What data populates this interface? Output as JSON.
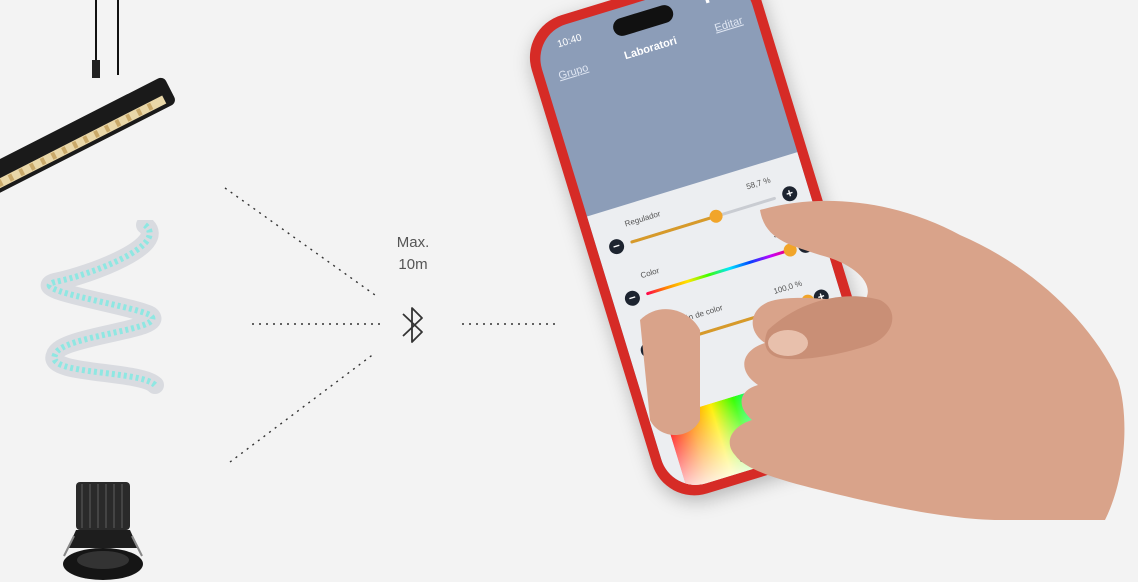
{
  "range": {
    "line1": "Max.",
    "line2": "10m"
  },
  "phone": {
    "status_time": "10:40",
    "nav": {
      "back": "Grupo",
      "title": "Laboratori",
      "edit": "Editar"
    },
    "controls": [
      {
        "label": "Regulador",
        "value": "58,7 %",
        "level": 0.587,
        "type": "plain"
      },
      {
        "label": "Color",
        "value": "358",
        "level": 0.99,
        "type": "rainbow"
      },
      {
        "label": "Saturación de color",
        "value": "100,0 %",
        "level": 1.0,
        "type": "plain"
      }
    ]
  },
  "icons": {
    "bluetooth": "bluetooth-icon"
  },
  "colors": {
    "phone_case": "#d62b26",
    "screen_header": "#8c9db8",
    "knob": "#f1a52a"
  }
}
